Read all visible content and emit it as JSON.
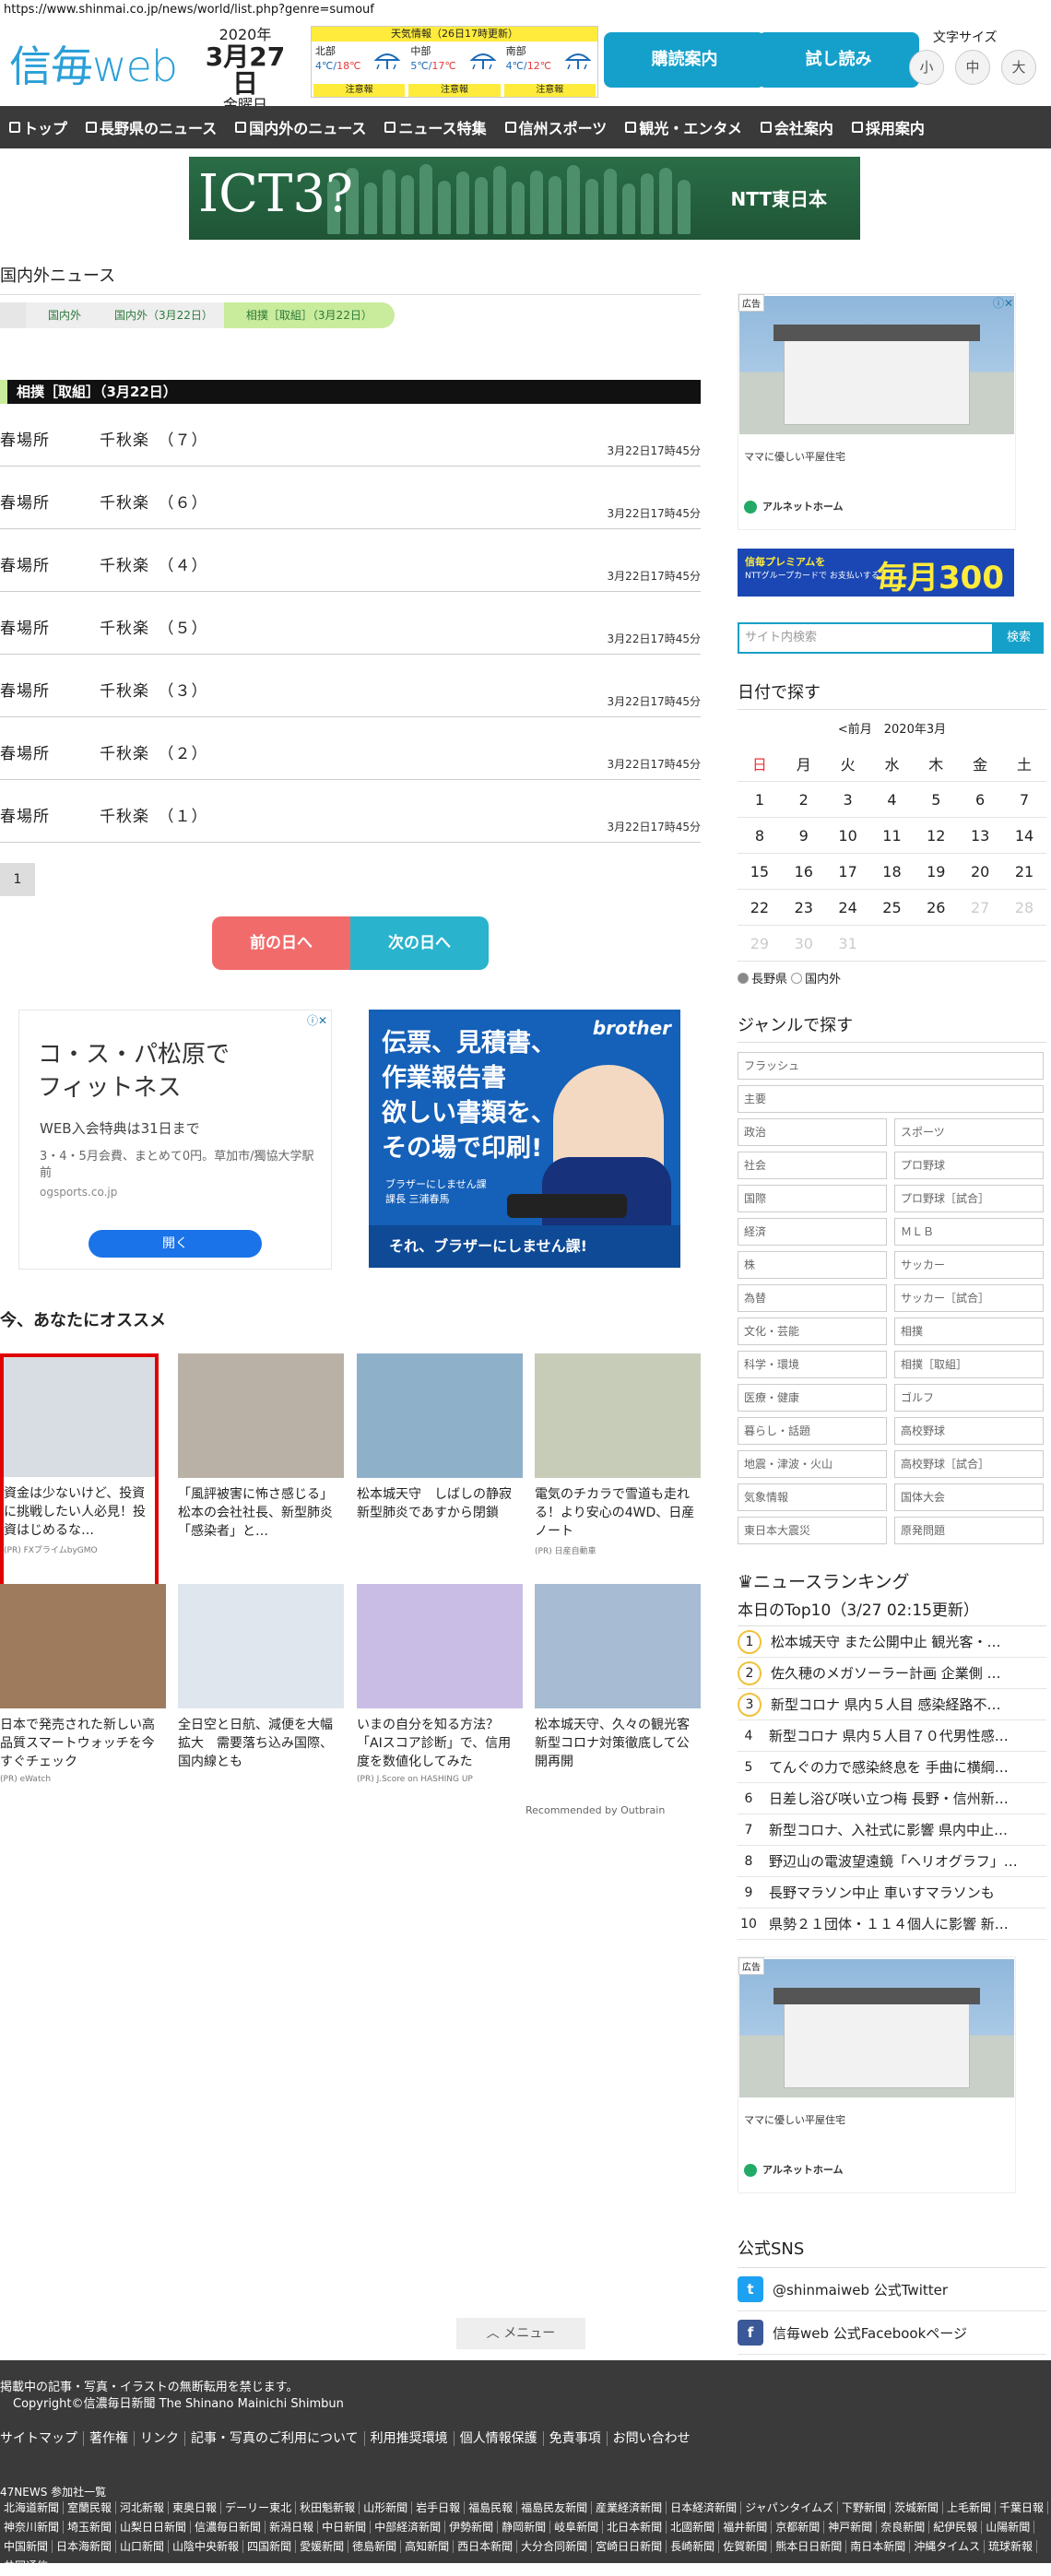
{
  "url": "https://www.shinmai.co.jp/news/world/list.php?genre=sumouf",
  "header": {
    "logo_text": "信毎",
    "logo_suffix": "web",
    "date": {
      "year": "2020年",
      "monthday": "3月27日",
      "weekday": "金曜日"
    },
    "weather": {
      "title": "天気情報（26日17時更新）",
      "regions": [
        {
          "name": "北部",
          "low": "4℃",
          "high": "18℃",
          "alert": "注意報"
        },
        {
          "name": "中部",
          "low": "5℃",
          "high": "17℃",
          "alert": "注意報"
        },
        {
          "name": "南部",
          "low": "4℃",
          "high": "12℃",
          "alert": "注意報"
        }
      ]
    },
    "subscribe_label": "購読案内",
    "trial_label": "試し読み",
    "font_size_label": "文字サイズ",
    "font_sizes": [
      "小",
      "中",
      "大"
    ]
  },
  "nav": [
    "トップ",
    "長野県のニュース",
    "国内外のニュース",
    "ニュース特集",
    "信州スポーツ",
    "観光・エンタメ",
    "会社案内",
    "採用案内"
  ],
  "top_banner": {
    "title": "ICT3?",
    "brand": "NTT東日本"
  },
  "main": {
    "section_title": "国内外ニュース",
    "breadcrumb": [
      "国内外",
      "国内外（3月22日）",
      "相撲［取組］（3月22日）"
    ],
    "category_heading": "相撲［取組］（3月22日）",
    "articles": [
      {
        "title": "春場所　　　千秋楽　（７）",
        "time": "3月22日17時45分"
      },
      {
        "title": "春場所　　　千秋楽　（６）",
        "time": "3月22日17時45分"
      },
      {
        "title": "春場所　　　千秋楽　（４）",
        "time": "3月22日17時45分"
      },
      {
        "title": "春場所　　　千秋楽　（５）",
        "time": "3月22日17時45分"
      },
      {
        "title": "春場所　　　千秋楽　（３）",
        "time": "3月22日17時45分"
      },
      {
        "title": "春場所　　　千秋楽　（２）",
        "time": "3月22日17時45分"
      },
      {
        "title": "春場所　　　千秋楽　（１）",
        "time": "3月22日17時45分"
      }
    ],
    "page": "1",
    "prev_day": "前の日へ",
    "next_day": "次の日へ"
  },
  "ads": {
    "ad1": {
      "headline1": "コ・ス・パ松原で",
      "headline2": "フィットネス",
      "line1": "WEB入会特典は31日まで",
      "line2": "3・4・5月会費、まとめて0円。草加市/獨協大学駅前",
      "domain": "ogsports.co.jp",
      "button": "開く"
    },
    "ad2": {
      "brand": "brother",
      "l1": "伝票、見積書、",
      "l2": "作業報告書",
      "l3": "欲しい書類を、",
      "l4": "その場で印刷!",
      "small1": "ブラザーにしません課",
      "small2": "課長 三浦春馬",
      "footer": "それ、ブラザーにしません課!"
    }
  },
  "recommend": {
    "title": "今、あなたにオススメ",
    "cards": [
      {
        "text": "資金は少ないけど、投資に挑戦したい人必見！投資はじめるな…",
        "src": "(PR) FXプライムbyGMO"
      },
      {
        "text": "「風評被害に怖さ感じる」　松本の会社社長、新型肺炎「感染者」と…",
        "src": ""
      },
      {
        "text": "松本城天守　しばしの静寂　新型肺炎であすから閉鎖",
        "src": ""
      },
      {
        "text": "電気のチカラで雪道も走れる！より安心の4WD、日産ノート",
        "src": "(PR) 日産自動車"
      },
      {
        "text": "日本で発売された新しい高品質スマートウォッチを今すぐチェック",
        "src": "(PR) eWatch"
      },
      {
        "text": "全日空と日航、減便を大幅拡大　需要落ち込み国際、国内線とも",
        "src": ""
      },
      {
        "text": "いまの自分を知る方法？「AIスコア診断」で、信用度を数値化してみた",
        "src": "(PR) J.Score on HASHING UP"
      },
      {
        "text": "松本城天守、久々の観光客　新型コロナ対策徹底して公開再開",
        "src": ""
      }
    ],
    "powered": "Recommended by Outbrain"
  },
  "sidebar": {
    "ad_label": "広告",
    "ad_caption": "ママに優しい平屋住宅",
    "ad_company": "アルネットホーム",
    "premium": {
      "a": "信毎プレミアムを",
      "b": "NTTグループカードで お支払いすると",
      "c": "毎月300円"
    },
    "search_placeholder": "サイト内検索",
    "search_button": "検索",
    "calendar_title": "日付で探す",
    "calendar_nav": "<前月　2020年3月",
    "weekdays": [
      "日",
      "月",
      "火",
      "水",
      "木",
      "金",
      "土"
    ],
    "weeks": [
      [
        "1",
        "2",
        "3",
        "4",
        "5",
        "6",
        "7"
      ],
      [
        "8",
        "9",
        "10",
        "11",
        "12",
        "13",
        "14"
      ],
      [
        "15",
        "16",
        "17",
        "18",
        "19",
        "20",
        "21"
      ],
      [
        "22",
        "23",
        "24",
        "25",
        "26",
        "27",
        "28"
      ],
      [
        "29",
        "30",
        "31",
        "",
        "",
        "",
        ""
      ]
    ],
    "region": [
      "長野県",
      "国内外"
    ],
    "genre_title": "ジャンルで探す",
    "genres_full": [
      "フラッシュ",
      "主要"
    ],
    "genres": [
      "政治",
      "スポーツ",
      "社会",
      "プロ野球",
      "国際",
      "プロ野球［試合］",
      "経済",
      "ＭＬＢ",
      "株",
      "サッカー",
      "為替",
      "サッカー［試合］",
      "文化・芸能",
      "相撲",
      "科学・環境",
      "相撲［取組］",
      "医療・健康",
      "ゴルフ",
      "暮らし・話題",
      "高校野球",
      "地震・津波・火山",
      "高校野球［試合］",
      "気象情報",
      "国体大会",
      "東日本大震災",
      "原発問題"
    ],
    "ranking_title": "ニュースランキング",
    "ranking_sub": "本日のTop10（3/27 02:15更新）",
    "ranking": [
      "松本城天守 また公開中止 観光客・…",
      "佐久穂のメガソーラー計画 企業側 …",
      "新型コロナ 県内５人目 感染経路不…",
      "新型コロナ 県内５人目７０代男性感…",
      "てんぐの力で感染終息を 手曲に横綱…",
      "日差し浴び咲い立つ梅 長野・信州新…",
      "新型コロナ、入社式に影響 県内中止…",
      "野辺山の電波望遠鏡「ヘリオグラフ」…",
      "長野マラソン中止 車いすマラソンも",
      "県勢２１団体・１１４個人に影響 新…"
    ],
    "social_title": "公式SNS",
    "twitter": "@shinmaiweb 公式Twitter",
    "facebook": "信毎web 公式Facebookページ"
  },
  "menu_tab": "メニュー",
  "footer": {
    "notice": "掲載中の記事・写真・イラストの無断転用を禁じます。",
    "copyright": "Copyright©信濃毎日新聞 The Shinano Mainichi Shimbun",
    "links": [
      "サイトマップ",
      "著作権",
      "リンク",
      "記事・写真のご利用について",
      "利用推奨環境",
      "個人情報保護",
      "免責事項",
      "お問い合わせ"
    ],
    "np_title": "47NEWS 参加社一覧",
    "newspapers": [
      "北海道新聞",
      "室蘭民報",
      "河北新報",
      "東奥日報",
      "デーリー東北",
      "秋田魁新報",
      "山形新聞",
      "岩手日報",
      "福島民報",
      "福島民友新聞",
      "産業経済新聞",
      "日本経済新聞",
      "ジャパンタイムズ",
      "下野新聞",
      "茨城新聞",
      "上毛新聞",
      "千葉日報",
      "神奈川新聞",
      "埼玉新聞",
      "山梨日日新聞",
      "信濃毎日新聞",
      "新潟日報",
      "中日新聞",
      "中部経済新聞",
      "伊勢新聞",
      "静岡新聞",
      "岐阜新聞",
      "北日本新聞",
      "北國新聞",
      "福井新聞",
      "京都新聞",
      "神戸新聞",
      "奈良新聞",
      "紀伊民報",
      "山陽新聞",
      "中国新聞",
      "日本海新聞",
      "山口新聞",
      "山陰中央新報",
      "四国新聞",
      "愛媛新聞",
      "徳島新聞",
      "高知新聞",
      "西日本新聞",
      "大分合同新聞",
      "宮崎日日新聞",
      "長崎新聞",
      "佐賀新聞",
      "熊本日日新聞",
      "南日本新聞",
      "沖縄タイムス",
      "琉球新報",
      "共同通信"
    ]
  }
}
